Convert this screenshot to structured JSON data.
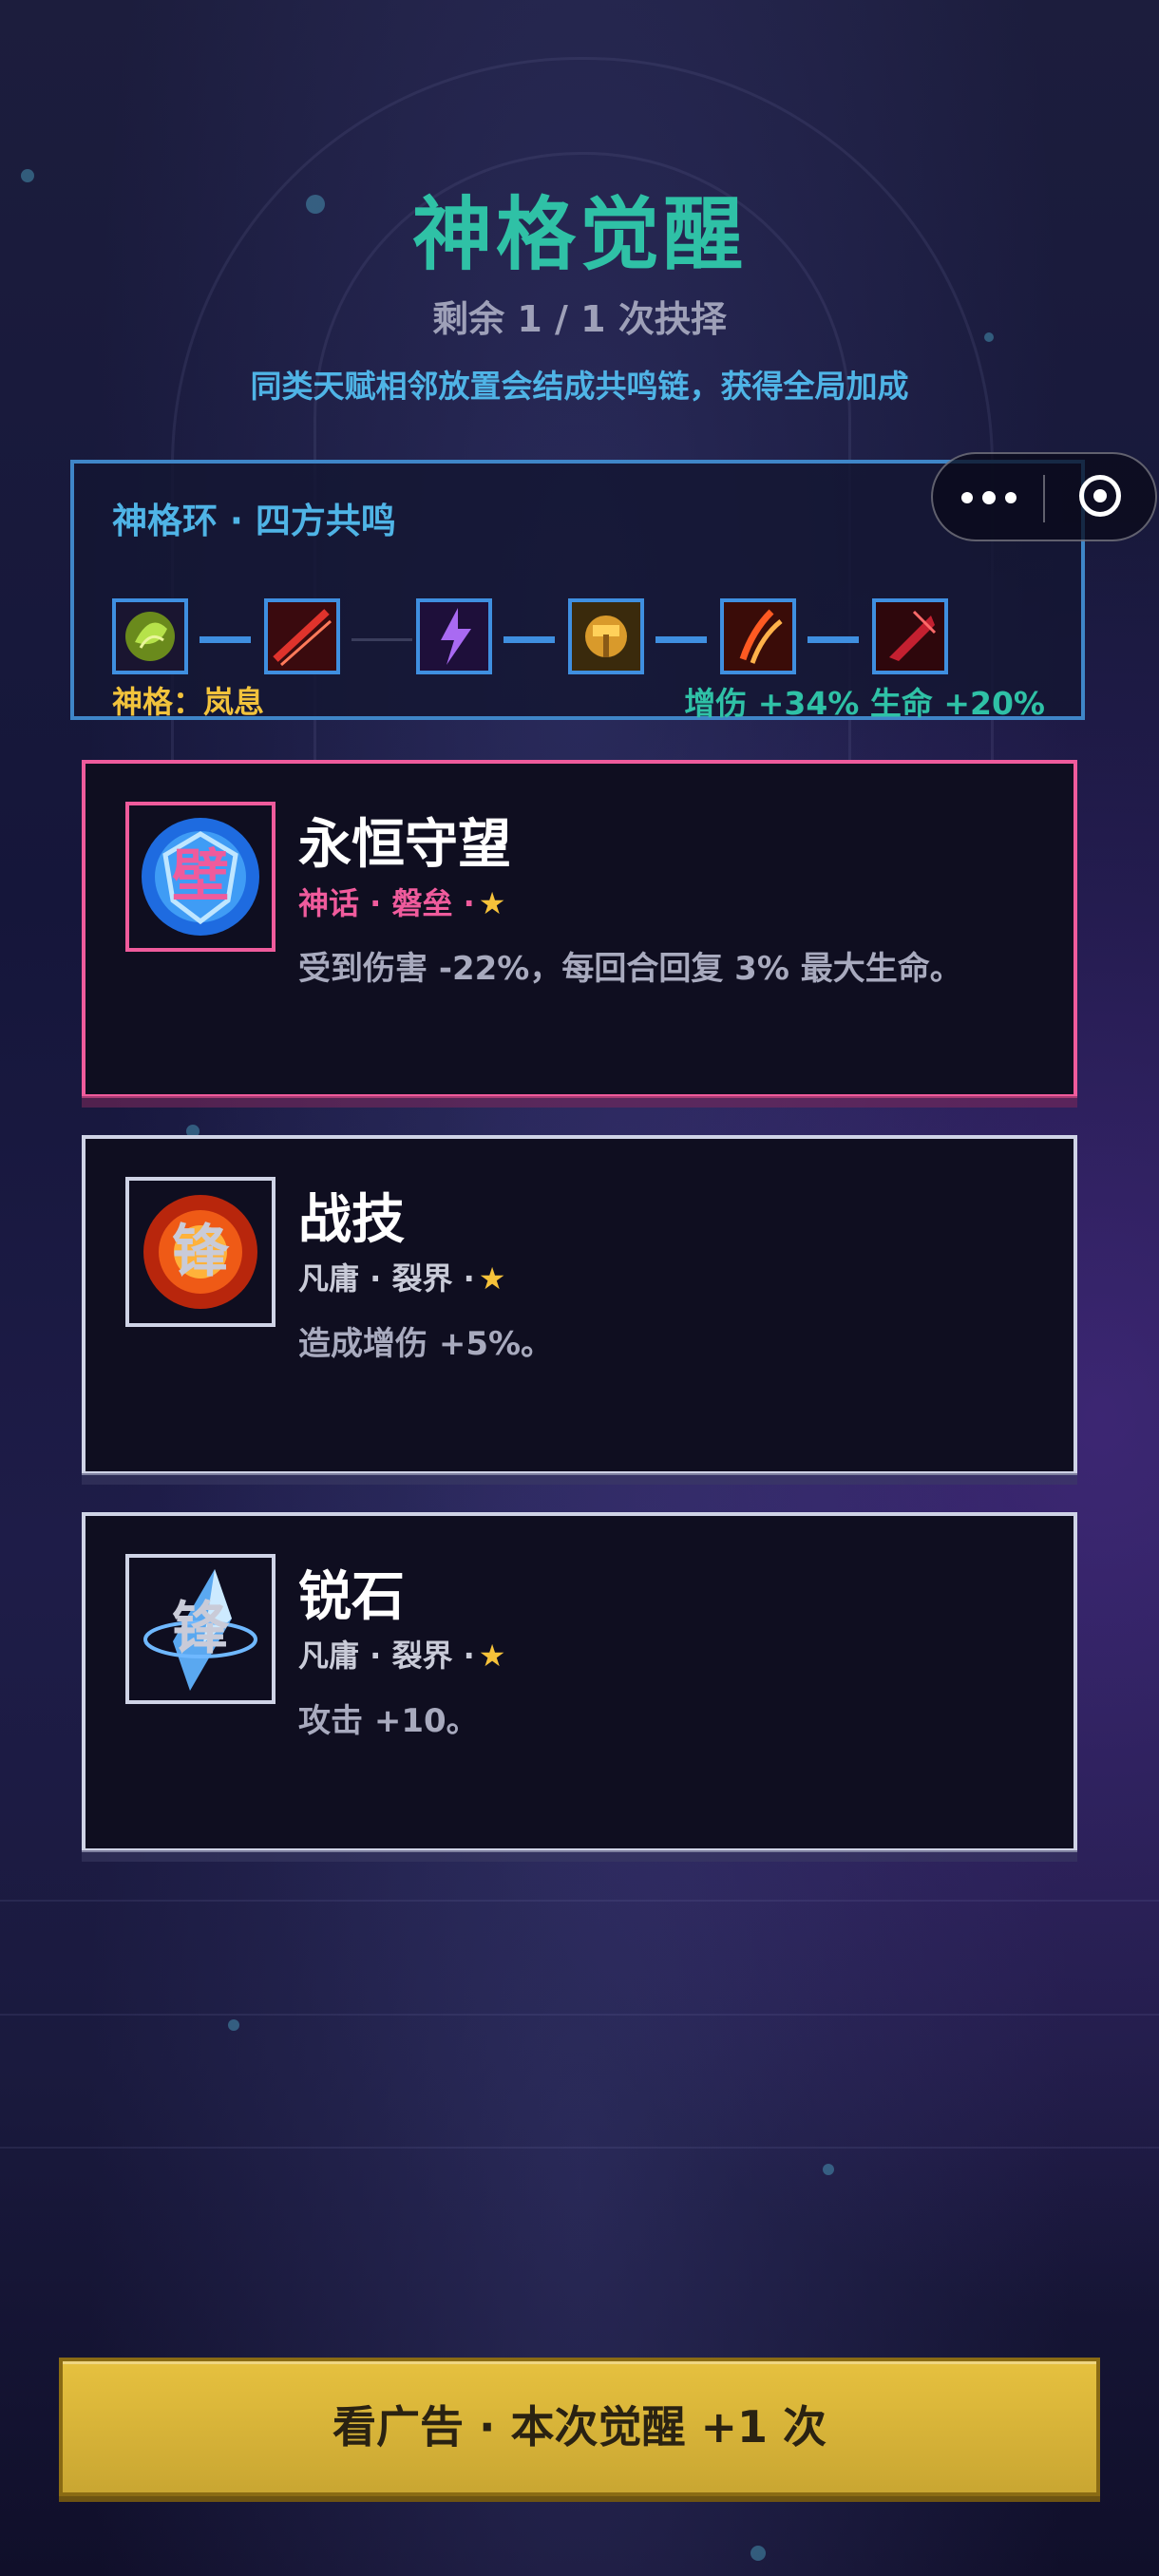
{
  "header": {
    "title": "神格觉醒",
    "remaining": "剩余 1 / 1 次抉择",
    "hint": "同类天赋相邻放置会结成共鸣链，获得全局加成"
  },
  "ring": {
    "title": "神格环 · 四方共鸣",
    "deity": "神格：岚息",
    "bonus": "增伤 +34% 生命 +20%",
    "slots": [
      {
        "icon": "green-leaf-orb-icon"
      },
      {
        "icon": "red-slash-icon"
      },
      {
        "icon": "purple-lightning-icon"
      },
      {
        "icon": "gold-hammer-icon"
      },
      {
        "icon": "flame-claw-icon"
      },
      {
        "icon": "crimson-blade-icon"
      }
    ],
    "accent": "#3f8fe0"
  },
  "capsule": {
    "menu_icon": "more-dots-icon",
    "close_icon": "target-circle-icon"
  },
  "cards": [
    {
      "name": "永恒守望",
      "tags": "神话 · 磐垒 ·",
      "desc": "受到伤害 -22%，每回合回复 3% 最大生命。",
      "glyph": "壁",
      "icon": "blue-shield-orb-icon",
      "rarity_color": "#ef5b9c"
    },
    {
      "name": "战技",
      "tags": "凡庸 · 裂界 ·",
      "desc": "造成增伤 +5%。",
      "glyph": "锋",
      "icon": "fire-burst-icon",
      "rarity_color": "#cfd3e6"
    },
    {
      "name": "锐石",
      "tags": "凡庸 · 裂界 ·",
      "desc": "攻击 +10。",
      "glyph": "锋",
      "icon": "ice-crystal-icon",
      "rarity_color": "#cfd3e6"
    }
  ],
  "star": "★",
  "ad_button": "看广告 · 本次觉醒 +1 次",
  "colors": {
    "title": "#2fc1a6",
    "hint": "#4fb4e6",
    "gold": "#f2c33c",
    "button": "#e6c13f"
  }
}
